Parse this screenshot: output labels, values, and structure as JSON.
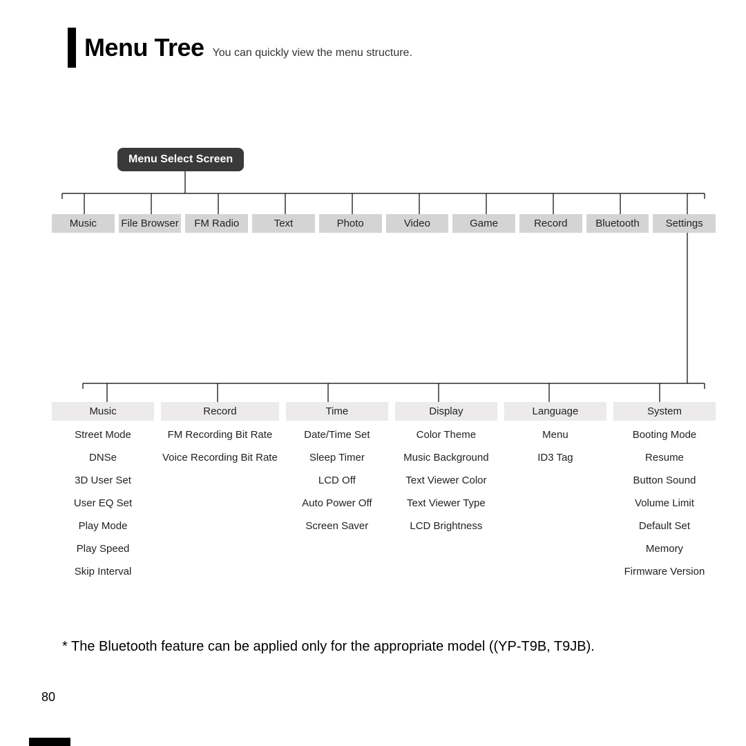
{
  "header": {
    "title": "Menu Tree",
    "subtitle": "You can quickly view the menu structure."
  },
  "root": "Menu Select Screen",
  "top_row": [
    "Music",
    "File Browser",
    "FM Radio",
    "Text",
    "Photo",
    "Video",
    "Game",
    "Record",
    "Bluetooth",
    "Settings"
  ],
  "columns": [
    {
      "head": "Music",
      "items": [
        "Street Mode",
        "DNSe",
        "3D User Set",
        "User EQ Set",
        "Play Mode",
        "Play Speed",
        "Skip Interval"
      ]
    },
    {
      "head": "Record",
      "items": [
        "FM Recording Bit Rate",
        "Voice Recording Bit Rate"
      ]
    },
    {
      "head": "Time",
      "items": [
        "Date/Time Set",
        "Sleep Timer",
        "LCD Off",
        "Auto Power Off",
        "Screen Saver"
      ]
    },
    {
      "head": "Display",
      "items": [
        "Color Theme",
        "Music Background",
        "Text Viewer Color",
        "Text Viewer Type",
        "LCD Brightness"
      ]
    },
    {
      "head": "Language",
      "items": [
        "Menu",
        "ID3 Tag"
      ]
    },
    {
      "head": "System",
      "items": [
        "Booting Mode",
        "Resume",
        "Button Sound",
        "Volume Limit",
        "Default Set",
        "Memory",
        "Firmware Version"
      ]
    }
  ],
  "footnote": "* The Bluetooth feature can be applied only for the appropriate model ((YP-T9B, T9JB).",
  "page_number": "80"
}
